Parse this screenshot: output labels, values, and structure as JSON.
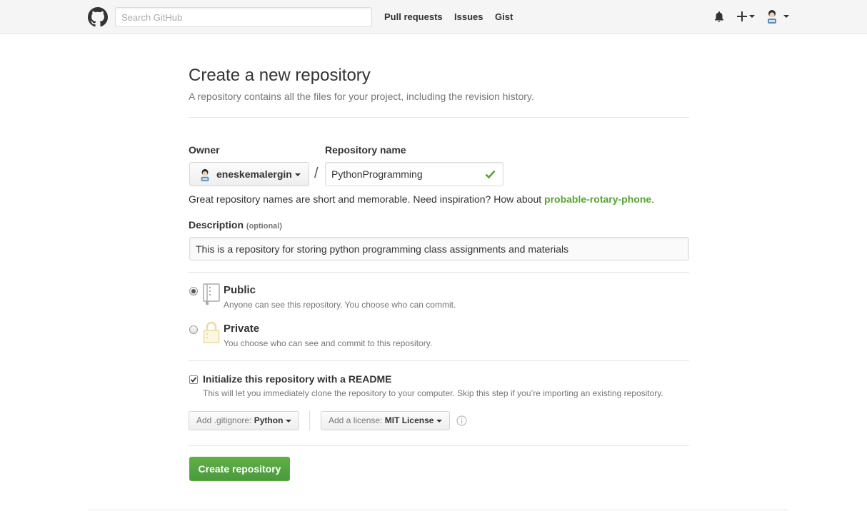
{
  "header": {
    "search_placeholder": "Search GitHub",
    "nav": [
      "Pull requests",
      "Issues",
      "Gist"
    ]
  },
  "page": {
    "title": "Create a new repository",
    "subtitle": "A repository contains all the files for your project, including the revision history."
  },
  "form": {
    "owner_label": "Owner",
    "owner_value": "eneskemalergin",
    "repo_name_label": "Repository name",
    "repo_name_value": "PythonProgramming",
    "slash": "/",
    "hint_prefix": "Great repository names are short and memorable. Need inspiration? How about ",
    "hint_suggestion": "probable-rotary-phone",
    "hint_suffix": ".",
    "description_label": "Description",
    "description_optional": "(optional)",
    "description_value": "This is a repository for storing python programming class assignments and materials",
    "visibility": {
      "selected": "Public",
      "public_title": "Public",
      "public_desc": "Anyone can see this repository. You choose who can commit.",
      "private_title": "Private",
      "private_desc": "You choose who can see and commit to this repository."
    },
    "readme": {
      "checked": true,
      "title": "Initialize this repository with a README",
      "desc": "This will let you immediately clone the repository to your computer. Skip this step if you’re importing an existing repository."
    },
    "gitignore_prefix": "Add .gitignore:",
    "gitignore_value": "Python",
    "license_prefix": "Add a license:",
    "license_value": "MIT License",
    "submit_label": "Create repository"
  },
  "colors": {
    "accent_green": "#55a532",
    "button_green": "#60b044"
  }
}
